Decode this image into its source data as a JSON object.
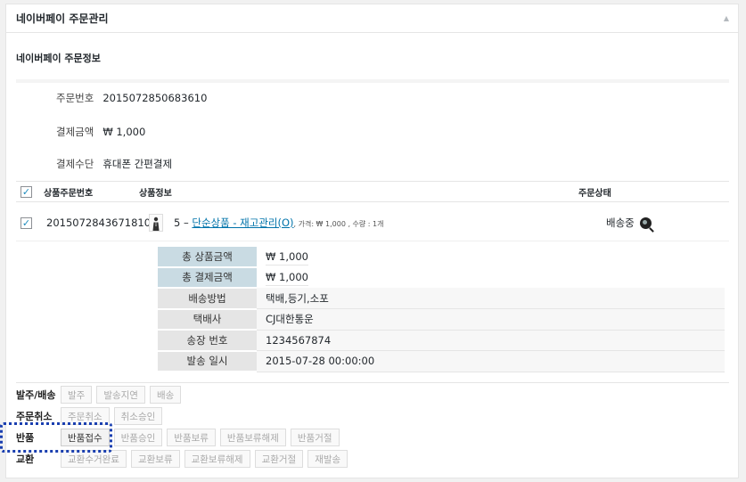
{
  "panel": {
    "title": "네이버페이 주문관리"
  },
  "section_title": "네이버페이 주문정보",
  "order_info": [
    {
      "label": "주문번호",
      "value": "2015072850683610"
    },
    {
      "label": "결제금액",
      "value": "₩ 1,000"
    },
    {
      "label": "결제수단",
      "value": "휴대폰 간편결제"
    }
  ],
  "table": {
    "headers": [
      "상품주문번호",
      "상품정보",
      "주문상태"
    ],
    "row": {
      "product_order_no": "2015072843671810",
      "product_prefix": "5 – ",
      "product_link": "단순상품 - 재고관리(O)",
      "product_note": ", 가격: ₩ 1,000 , 수량 : 1개",
      "status": "배송중"
    }
  },
  "details": [
    {
      "label": "총 상품금액",
      "value": "₩ 1,000"
    },
    {
      "label": "총 결제금액",
      "value": "₩ 1,000"
    },
    {
      "label": "배송방법",
      "value": "택배,등기,소포"
    },
    {
      "label": "택배사",
      "value": "CJ대한통운"
    },
    {
      "label": "송장 번호",
      "value": "1234567874"
    },
    {
      "label": "발송 일시",
      "value": "2015-07-28 00:00:00"
    }
  ],
  "actions": [
    {
      "label": "발주/배송",
      "buttons": [
        "발주",
        "발송지연",
        "배송"
      ]
    },
    {
      "label": "주문취소",
      "buttons": [
        "주문취소",
        "취소승인"
      ]
    },
    {
      "label": "반품",
      "buttons": [
        "반품접수",
        "반품승인",
        "반품보류",
        "반품보류해제",
        "반품거절"
      ]
    },
    {
      "label": "교환",
      "buttons": [
        "교환수거완료",
        "교환보류",
        "교환보류해제",
        "교환거절",
        "재발송"
      ]
    }
  ],
  "icons": {
    "toggle": "triangle-up-icon",
    "status": "magnifier-icon",
    "thumb": "product-thumbnail-icon"
  },
  "colors": {
    "link": "#0073aa",
    "label_blue": "#c9dbe3",
    "highlight": "#1a3fb0"
  }
}
